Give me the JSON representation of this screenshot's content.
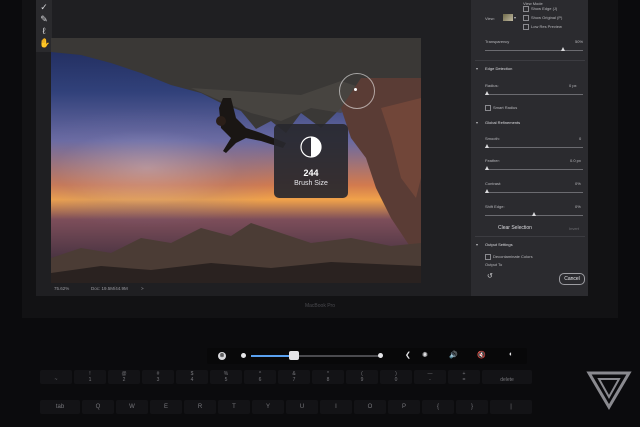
{
  "canvas": {
    "zoom": "75.62%",
    "doc": "Doc: 19.5M/44.9M",
    "arrow": ">"
  },
  "brush_hud": {
    "value": "244",
    "label": "Brush Size"
  },
  "panel": {
    "view_mode_label": "View Mode",
    "view_label": "View:",
    "show_edge": "Show Edge (J)",
    "show_original": "Show Original (P)",
    "low_res_preview": "Low Res Preview",
    "transparency_label": "Transparency",
    "transparency_value": "50%",
    "edge_detection_title": "Edge Detection",
    "radius_label": "Radius:",
    "radius_value": "0 px",
    "smart_radius": "Smart Radius",
    "global_refinements_title": "Global Refinements",
    "smooth_label": "Smooth:",
    "smooth_value": "0",
    "feather_label": "Feather:",
    "feather_value": "0.0 px",
    "contrast_label": "Contrast:",
    "contrast_value": "0%",
    "shift_edge_label": "Shift Edge:",
    "shift_edge_value": "0%",
    "clear_selection": "Clear Selection",
    "invert": "Invert",
    "output_settings_title": "Output Settings",
    "decontaminate": "Decontaminate Colors",
    "output_to": "Output To",
    "cancel": "Cancel",
    "ok": "OK",
    "undo_icon": "↺"
  },
  "brand_text": "MacBook Pro",
  "touchbar": {
    "esc_icon": "⊗",
    "brush_size_fraction": 0.33,
    "icons": [
      "❮",
      "✺",
      "🔊",
      "🔇",
      "◐"
    ]
  },
  "keyboard": {
    "number_row": [
      {
        "top": "",
        "bottom": "~"
      },
      {
        "top": "!",
        "bottom": "1"
      },
      {
        "top": "@",
        "bottom": "2"
      },
      {
        "top": "#",
        "bottom": "3"
      },
      {
        "top": "$",
        "bottom": "4"
      },
      {
        "top": "%",
        "bottom": "5"
      },
      {
        "top": "^",
        "bottom": "6"
      },
      {
        "top": "&",
        "bottom": "7"
      },
      {
        "top": "*",
        "bottom": "8"
      },
      {
        "top": "(",
        "bottom": "9"
      },
      {
        "top": ")",
        "bottom": "0"
      },
      {
        "top": "—",
        "bottom": "-"
      },
      {
        "top": "+",
        "bottom": "="
      },
      {
        "top": "",
        "bottom": "delete"
      }
    ],
    "letter_row": [
      "tab",
      "Q",
      "W",
      "E",
      "R",
      "T",
      "Y",
      "U",
      "I",
      "O",
      "P",
      "{",
      "}",
      "|"
    ]
  },
  "colors": {
    "accent": "#5aa1f0",
    "panel_bg": "#2b2b2f"
  }
}
